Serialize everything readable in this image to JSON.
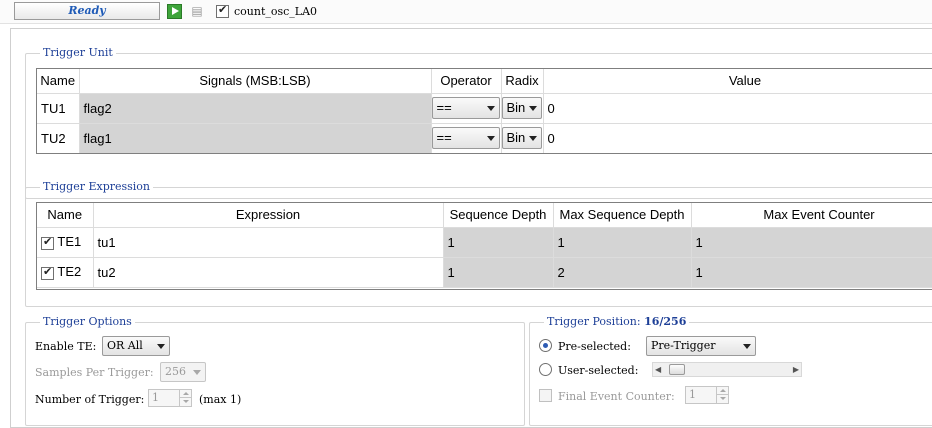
{
  "toolbar": {
    "status": "Ready",
    "instance_label": "count_osc_LA0",
    "instance_checked": true
  },
  "trigger_unit": {
    "title": "Trigger Unit",
    "columns": [
      "Name",
      "Signals (MSB:LSB)",
      "Operator",
      "Radix",
      "Value"
    ],
    "rows": [
      {
        "name": "TU1",
        "signal": "flag2",
        "operator": "==",
        "radix": "Bin",
        "value": "0"
      },
      {
        "name": "TU2",
        "signal": "flag1",
        "operator": "==",
        "radix": "Bin",
        "value": "0"
      }
    ]
  },
  "trigger_expression": {
    "title": "Trigger Expression",
    "columns": [
      "Name",
      "Expression",
      "Sequence Depth",
      "Max Sequence Depth",
      "Max Event Counter"
    ],
    "rows": [
      {
        "checked": true,
        "name": "TE1",
        "expression": "tu1",
        "seq_depth": "1",
        "max_seq_depth": "1",
        "max_event": "1"
      },
      {
        "checked": true,
        "name": "TE2",
        "expression": "tu2",
        "seq_depth": "1",
        "max_seq_depth": "2",
        "max_event": "1"
      }
    ]
  },
  "trigger_options": {
    "title": "Trigger Options",
    "enable_te_label": "Enable TE:",
    "enable_te_value": "OR All",
    "samples_label": "Samples Per Trigger:",
    "samples_value": "256",
    "number_label": "Number of Trigger:",
    "number_value": "1",
    "number_hint": "(max 1)"
  },
  "trigger_position": {
    "title": "Trigger Position:",
    "value": "16/256",
    "preselected_label": "Pre-selected:",
    "preselected_value": "Pre-Trigger",
    "userselected_label": "User-selected:",
    "final_event_label": "Final Event Counter:",
    "final_event_value": "1"
  },
  "colors": {
    "accent_text": "#1d3f97",
    "status_text": "#1f5bb7",
    "cell_gray": "#d4d4d4",
    "run_green": "#3ea43a"
  }
}
